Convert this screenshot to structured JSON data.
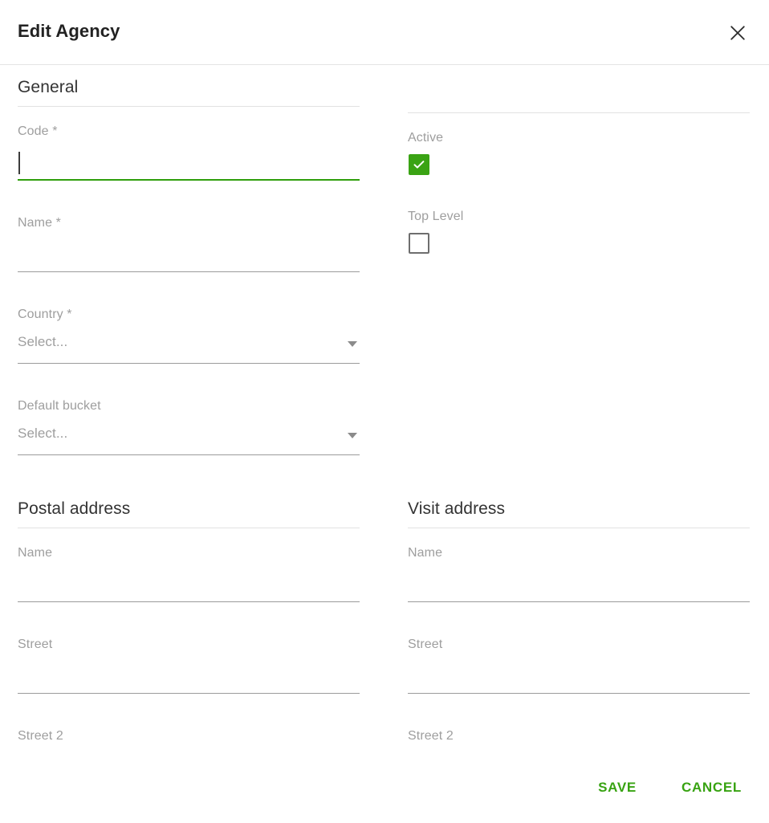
{
  "dialog": {
    "title": "Edit Agency",
    "close_icon": "close-icon"
  },
  "sections": {
    "general": {
      "heading": "General",
      "fields": {
        "code": {
          "label": "Code *",
          "value": "",
          "focused": true
        },
        "name": {
          "label": "Name *",
          "value": ""
        },
        "country": {
          "label": "Country *",
          "value": "Select..."
        },
        "default_bucket": {
          "label": "Default bucket",
          "value": "Select..."
        }
      },
      "toggles": {
        "active": {
          "label": "Active",
          "checked": true
        },
        "top_level": {
          "label": "Top Level",
          "checked": false
        }
      }
    },
    "postal_address": {
      "heading": "Postal address",
      "fields": {
        "name": {
          "label": "Name",
          "value": ""
        },
        "street": {
          "label": "Street",
          "value": ""
        },
        "street2": {
          "label": "Street 2",
          "value": ""
        }
      }
    },
    "visit_address": {
      "heading": "Visit address",
      "fields": {
        "name": {
          "label": "Name",
          "value": ""
        },
        "street": {
          "label": "Street",
          "value": ""
        },
        "street2": {
          "label": "Street 2",
          "value": ""
        }
      }
    }
  },
  "footer": {
    "save_label": "Save",
    "cancel_label": "Cancel"
  },
  "colors": {
    "accent_green": "#38a312",
    "focus_green": "#2f9e0c",
    "checkbox_green": "#3aa314",
    "label_gray": "#9e9e9e",
    "rule_gray": "#e2e2e2",
    "underline_gray": "#9b9b9b",
    "title_dark": "#222222"
  }
}
